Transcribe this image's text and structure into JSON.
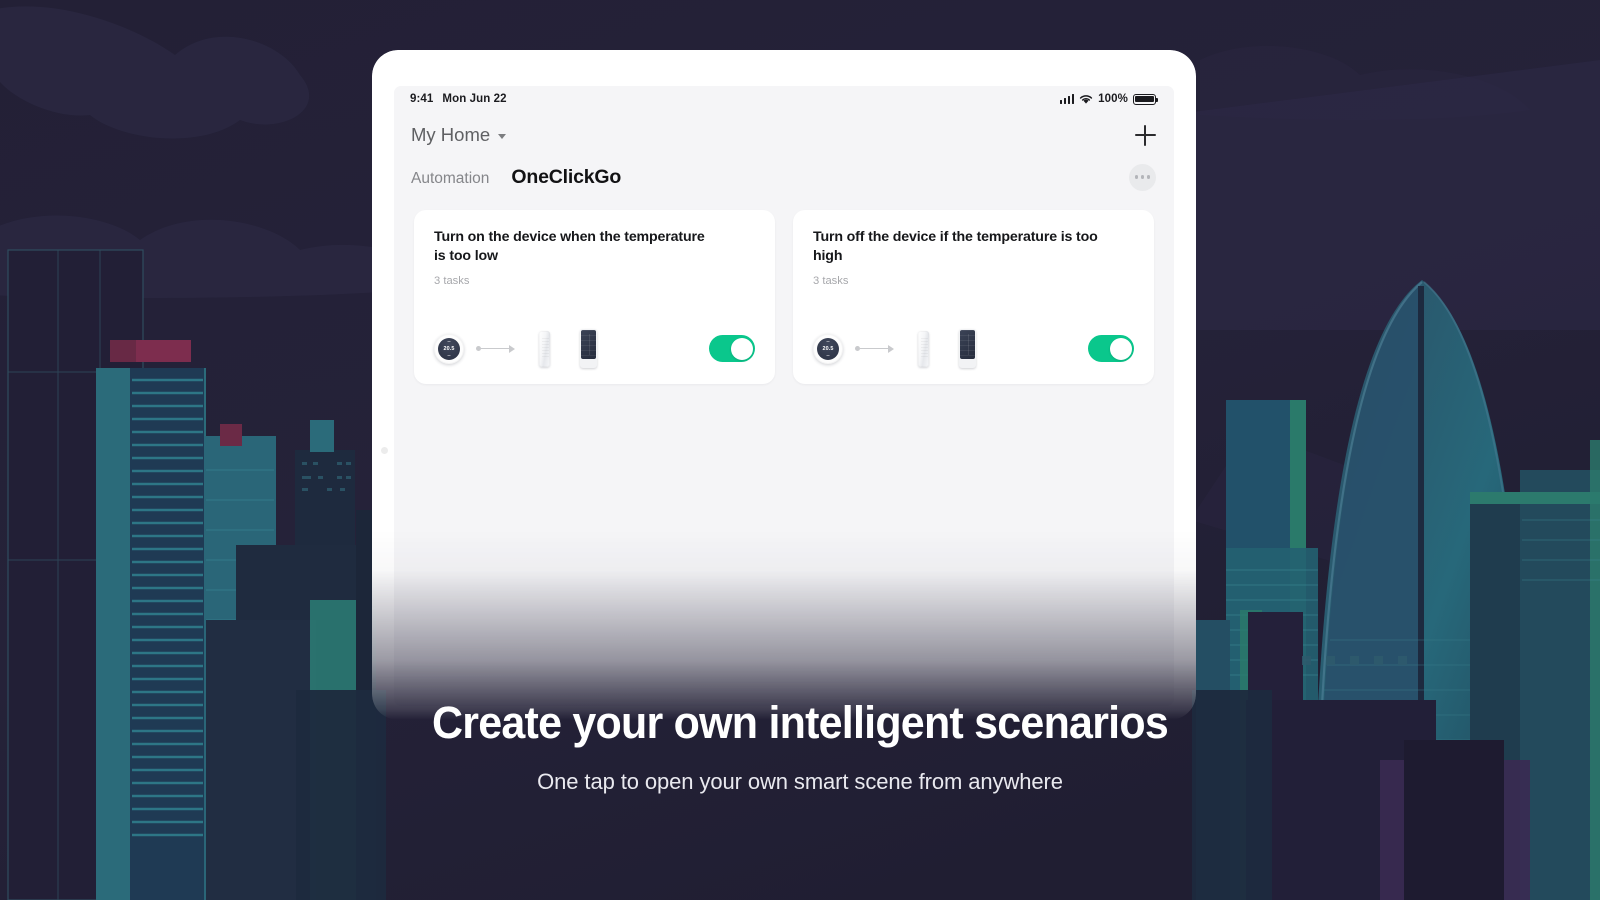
{
  "theme": {
    "background": "#232036",
    "accent_green": "#0ac78c",
    "tablet_body": "#ffffff",
    "screen_bg": "#f5f5f7",
    "card_bg": "#ffffff",
    "headline_color": "#ffffff",
    "city_teal": "#2c6a77",
    "city_magenta": "#7d2d4e"
  },
  "status_bar": {
    "time": "9:41",
    "date": "Mon Jun 22",
    "battery_percent": "100%",
    "signal_icon": "cellular-bars-icon",
    "wifi_icon": "wifi-icon",
    "battery_icon": "battery-full-icon"
  },
  "header": {
    "home_name": "My Home",
    "caret_icon": "chevron-down-icon",
    "add_icon": "plus-icon"
  },
  "tabs": {
    "items": [
      {
        "label": "Automation",
        "active": false
      },
      {
        "label": "OneClickGo",
        "active": true
      }
    ],
    "more_icon": "more-horizontal-icon"
  },
  "cards": [
    {
      "title": "Turn on the device when the temperature is too low",
      "subtitle": "3 tasks",
      "devices": [
        {
          "icon": "thermostat-dial-icon",
          "value": "20.5"
        },
        {
          "icon": "arrow-right-icon"
        },
        {
          "icon": "white-sensor-icon"
        },
        {
          "icon": "dark-keypad-panel-icon"
        }
      ],
      "toggle_on": true
    },
    {
      "title": "Turn off the device if the temperature is too high",
      "subtitle": "3 tasks",
      "devices": [
        {
          "icon": "thermostat-dial-icon",
          "value": "20.5"
        },
        {
          "icon": "arrow-right-icon"
        },
        {
          "icon": "white-sensor-icon"
        },
        {
          "icon": "dark-keypad-panel-icon"
        }
      ],
      "toggle_on": true
    }
  ],
  "caption": {
    "headline": "Create your own intelligent scenarios",
    "subline": "One tap to open your own smart scene from anywhere"
  }
}
